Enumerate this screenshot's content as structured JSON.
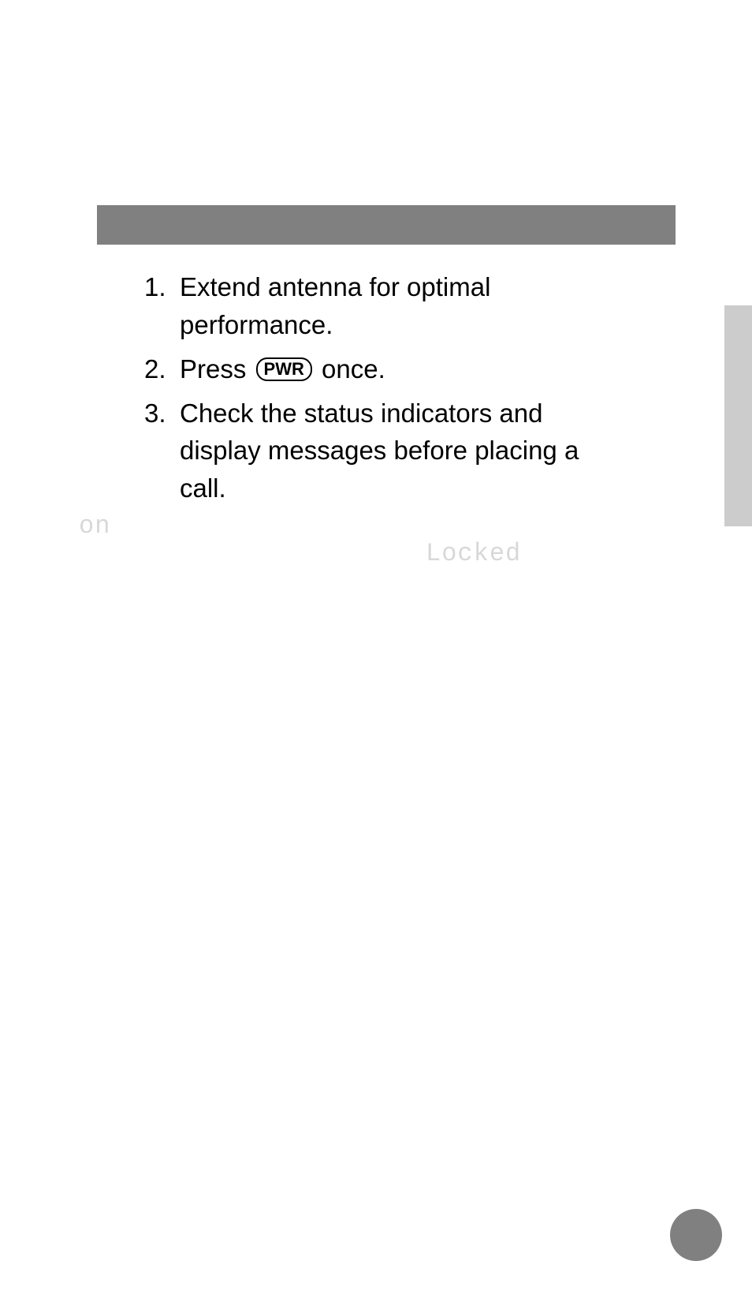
{
  "steps": [
    {
      "number": "1.",
      "text_before": "Extend antenna for optimal performance.",
      "button": null,
      "text_after": null
    },
    {
      "number": "2.",
      "text_before": "Press ",
      "button": "PWR",
      "text_after": " once."
    },
    {
      "number": "3.",
      "text_before": "Check the status indicators and display messages before placing a call.",
      "button": null,
      "text_after": null
    }
  ],
  "faded": {
    "on": "on",
    "locked": "Locked"
  }
}
